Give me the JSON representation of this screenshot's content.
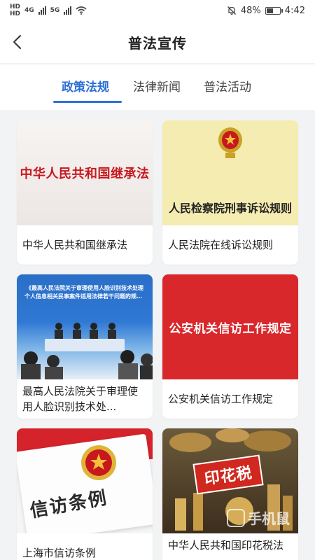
{
  "status_bar": {
    "left_tags": [
      "HD",
      "HD"
    ],
    "network_labels": [
      "4G",
      "5G"
    ],
    "battery": "48%",
    "battery_level": 0.48,
    "time": "4:42"
  },
  "header": {
    "title": "普法宣传"
  },
  "tabs": [
    {
      "label": "政策法规",
      "active": true
    },
    {
      "label": "法律新闻",
      "active": false
    },
    {
      "label": "普法活动",
      "active": false
    }
  ],
  "cards": [
    {
      "title": "中华人民共和国继承法",
      "image_text": "中华人民共和国继承法"
    },
    {
      "title": "人民法院在线诉讼规则",
      "image_text": "人民检察院刑事诉讼规则"
    },
    {
      "title": "最高人民法院关于审理使用人脸识别技术处...",
      "image_text": "《最高人民法院关于审理使用人脸识别技术处理个人信息相关民事案件适用法律若干问题的规定》新闻发布会"
    },
    {
      "title": "公安机关信访工作规定",
      "image_text": "公安机关信访工作规定"
    },
    {
      "title": "上海市信访条例",
      "image_text": "信访条例"
    },
    {
      "title": "中华人民共和国印花税法",
      "image_text": "印花税"
    }
  ],
  "watermark": {
    "text": "手机鼠"
  },
  "colors": {
    "accent": "#2b6fd6",
    "red": "#d9282c"
  }
}
